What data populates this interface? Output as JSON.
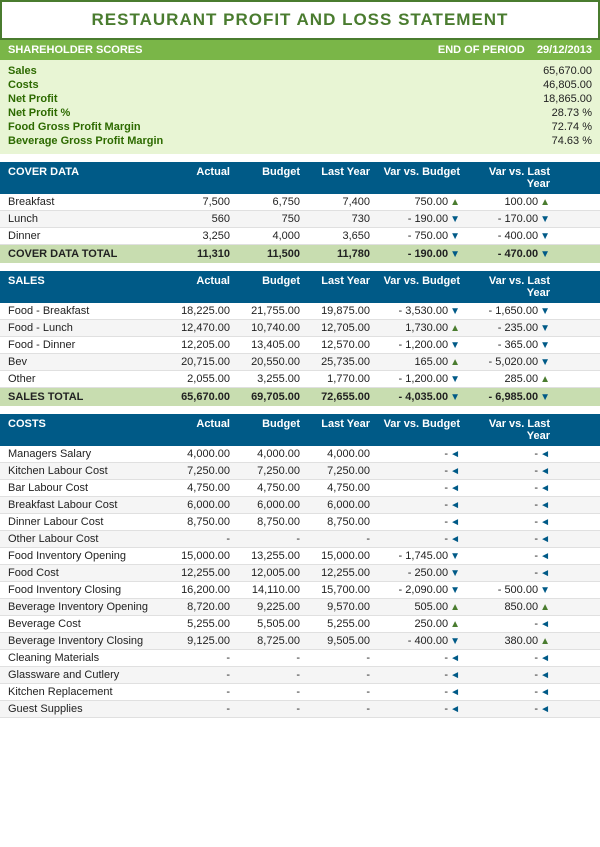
{
  "title": "RESTAURANT PROFIT AND LOSS STATEMENT",
  "shareholder": {
    "header_left": "SHAREHOLDER SCORES",
    "header_right_label": "END OF PERIOD",
    "header_date": "29/12/2013",
    "rows": [
      {
        "label": "Sales",
        "value": "65,670.00"
      },
      {
        "label": "Costs",
        "value": "46,805.00"
      },
      {
        "label": "Net Profit",
        "value": "18,865.00"
      },
      {
        "label": "Net Profit %",
        "value": "28.73 %"
      },
      {
        "label": "Food Gross Profit Margin",
        "value": "72.74 %"
      },
      {
        "label": "Beverage Gross Profit Margin",
        "value": "74.63 %"
      }
    ]
  },
  "cover_data": {
    "section_label": "COVER DATA",
    "cols": [
      "",
      "Actual",
      "Budget",
      "Last Year",
      "Var vs. Budget",
      "Var vs. Last Year"
    ],
    "rows": [
      {
        "label": "Breakfast",
        "actual": "7,500",
        "budget": "6,750",
        "last_year": "7,400",
        "var_budget": "750.00",
        "var_budget_dir": "up",
        "var_ly": "100.00",
        "var_ly_dir": "up"
      },
      {
        "label": "Lunch",
        "actual": "560",
        "budget": "750",
        "last_year": "730",
        "var_budget": "190.00",
        "var_budget_dir": "down",
        "var_budget_prefix": "-",
        "var_ly": "170.00",
        "var_ly_dir": "down",
        "var_ly_prefix": "-"
      },
      {
        "label": "Dinner",
        "actual": "3,250",
        "budget": "4,000",
        "last_year": "3,650",
        "var_budget": "750.00",
        "var_budget_dir": "down",
        "var_budget_prefix": "-",
        "var_ly": "400.00",
        "var_ly_dir": "down",
        "var_ly_prefix": "-"
      }
    ],
    "total": {
      "label": "COVER DATA TOTAL",
      "actual": "11,310",
      "budget": "11,500",
      "last_year": "11,780",
      "var_budget": "190.00",
      "var_budget_dir": "down",
      "var_budget_prefix": "-",
      "var_ly": "470.00",
      "var_ly_dir": "down",
      "var_ly_prefix": "-"
    }
  },
  "sales": {
    "section_label": "SALES",
    "cols": [
      "",
      "Actual",
      "Budget",
      "Last Year",
      "Var vs. Budget",
      "Var vs. Last Year"
    ],
    "rows": [
      {
        "label": "Food - Breakfast",
        "actual": "18,225.00",
        "budget": "21,755.00",
        "last_year": "19,875.00",
        "var_budget": "3,530.00",
        "var_budget_dir": "down",
        "var_budget_prefix": "-",
        "var_ly": "1,650.00",
        "var_ly_dir": "down",
        "var_ly_prefix": "-"
      },
      {
        "label": "Food - Lunch",
        "actual": "12,470.00",
        "budget": "10,740.00",
        "last_year": "12,705.00",
        "var_budget": "1,730.00",
        "var_budget_dir": "up",
        "var_budget_prefix": "",
        "var_ly": "235.00",
        "var_ly_dir": "down",
        "var_ly_prefix": "-"
      },
      {
        "label": "Food - Dinner",
        "actual": "12,205.00",
        "budget": "13,405.00",
        "last_year": "12,570.00",
        "var_budget": "1,200.00",
        "var_budget_dir": "down",
        "var_budget_prefix": "-",
        "var_ly": "365.00",
        "var_ly_dir": "down",
        "var_ly_prefix": "-"
      },
      {
        "label": "Bev",
        "actual": "20,715.00",
        "budget": "20,550.00",
        "last_year": "25,735.00",
        "var_budget": "165.00",
        "var_budget_dir": "up",
        "var_budget_prefix": "",
        "var_ly": "5,020.00",
        "var_ly_dir": "down",
        "var_ly_prefix": "-"
      },
      {
        "label": "Other",
        "actual": "2,055.00",
        "budget": "3,255.00",
        "last_year": "1,770.00",
        "var_budget": "1,200.00",
        "var_budget_dir": "down",
        "var_budget_prefix": "-",
        "var_ly": "285.00",
        "var_ly_dir": "up",
        "var_ly_prefix": ""
      }
    ],
    "total": {
      "label": "SALES TOTAL",
      "actual": "65,670.00",
      "budget": "69,705.00",
      "last_year": "72,655.00",
      "var_budget": "4,035.00",
      "var_budget_dir": "down",
      "var_budget_prefix": "-",
      "var_ly": "6,985.00",
      "var_ly_dir": "down",
      "var_ly_prefix": "-"
    }
  },
  "costs": {
    "section_label": "COSTS",
    "cols": [
      "",
      "Actual",
      "Budget",
      "Last Year",
      "Var vs. Budget",
      "Var vs. Last Year"
    ],
    "rows": [
      {
        "label": "Managers Salary",
        "actual": "4,000.00",
        "budget": "4,000.00",
        "last_year": "4,000.00",
        "var_budget": "-",
        "var_budget_dir": "left",
        "var_ly": "-",
        "var_ly_dir": "left"
      },
      {
        "label": "Kitchen Labour Cost",
        "actual": "7,250.00",
        "budget": "7,250.00",
        "last_year": "7,250.00",
        "var_budget": "-",
        "var_budget_dir": "left",
        "var_ly": "-",
        "var_ly_dir": "left"
      },
      {
        "label": "Bar Labour Cost",
        "actual": "4,750.00",
        "budget": "4,750.00",
        "last_year": "4,750.00",
        "var_budget": "-",
        "var_budget_dir": "left",
        "var_ly": "-",
        "var_ly_dir": "left"
      },
      {
        "label": "Breakfast Labour Cost",
        "actual": "6,000.00",
        "budget": "6,000.00",
        "last_year": "6,000.00",
        "var_budget": "-",
        "var_budget_dir": "left",
        "var_ly": "-",
        "var_ly_dir": "left"
      },
      {
        "label": "Dinner Labour Cost",
        "actual": "8,750.00",
        "budget": "8,750.00",
        "last_year": "8,750.00",
        "var_budget": "-",
        "var_budget_dir": "left",
        "var_ly": "-",
        "var_ly_dir": "left"
      },
      {
        "label": "Other Labour Cost",
        "actual": "-",
        "budget": "-",
        "last_year": "-",
        "var_budget": "-",
        "var_budget_dir": "left",
        "var_ly": "-",
        "var_ly_dir": "left"
      },
      {
        "label": "Food Inventory Opening",
        "actual": "15,000.00",
        "budget": "13,255.00",
        "last_year": "15,000.00",
        "var_budget": "1,745.00",
        "var_budget_dir": "down",
        "var_budget_prefix": "-",
        "var_ly": "-",
        "var_ly_dir": "left"
      },
      {
        "label": "Food Cost",
        "actual": "12,255.00",
        "budget": "12,005.00",
        "last_year": "12,255.00",
        "var_budget": "250.00",
        "var_budget_dir": "down",
        "var_budget_prefix": "-",
        "var_ly": "-",
        "var_ly_dir": "left"
      },
      {
        "label": "Food Inventory Closing",
        "actual": "16,200.00",
        "budget": "14,110.00",
        "last_year": "15,700.00",
        "var_budget": "2,090.00",
        "var_budget_dir": "down",
        "var_budget_prefix": "-",
        "var_ly": "500.00",
        "var_ly_dir": "down",
        "var_ly_prefix": "-"
      },
      {
        "label": "Beverage Inventory Opening",
        "actual": "8,720.00",
        "budget": "9,225.00",
        "last_year": "9,570.00",
        "var_budget": "505.00",
        "var_budget_dir": "up",
        "var_budget_prefix": "",
        "var_ly": "850.00",
        "var_ly_dir": "up",
        "var_ly_prefix": ""
      },
      {
        "label": "Beverage Cost",
        "actual": "5,255.00",
        "budget": "5,505.00",
        "last_year": "5,255.00",
        "var_budget": "250.00",
        "var_budget_dir": "up",
        "var_budget_prefix": "",
        "var_ly": "-",
        "var_ly_dir": "left"
      },
      {
        "label": "Beverage Inventory Closing",
        "actual": "9,125.00",
        "budget": "8,725.00",
        "last_year": "9,505.00",
        "var_budget": "400.00",
        "var_budget_dir": "down",
        "var_budget_prefix": "-",
        "var_ly": "380.00",
        "var_ly_dir": "up",
        "var_ly_prefix": ""
      },
      {
        "label": "Cleaning Materials",
        "actual": "-",
        "budget": "-",
        "last_year": "-",
        "var_budget": "-",
        "var_budget_dir": "left",
        "var_ly": "-",
        "var_ly_dir": "left"
      },
      {
        "label": "Glassware and Cutlery",
        "actual": "-",
        "budget": "-",
        "last_year": "-",
        "var_budget": "-",
        "var_budget_dir": "left",
        "var_ly": "-",
        "var_ly_dir": "left"
      },
      {
        "label": "Kitchen Replacement",
        "actual": "-",
        "budget": "-",
        "last_year": "-",
        "var_budget": "-",
        "var_budget_dir": "left",
        "var_ly": "-",
        "var_ly_dir": "left"
      },
      {
        "label": "Guest Supplies",
        "actual": "-",
        "budget": "-",
        "last_year": "-",
        "var_budget": "-",
        "var_budget_dir": "left",
        "var_ly": "-",
        "var_ly_dir": "left"
      }
    ]
  }
}
